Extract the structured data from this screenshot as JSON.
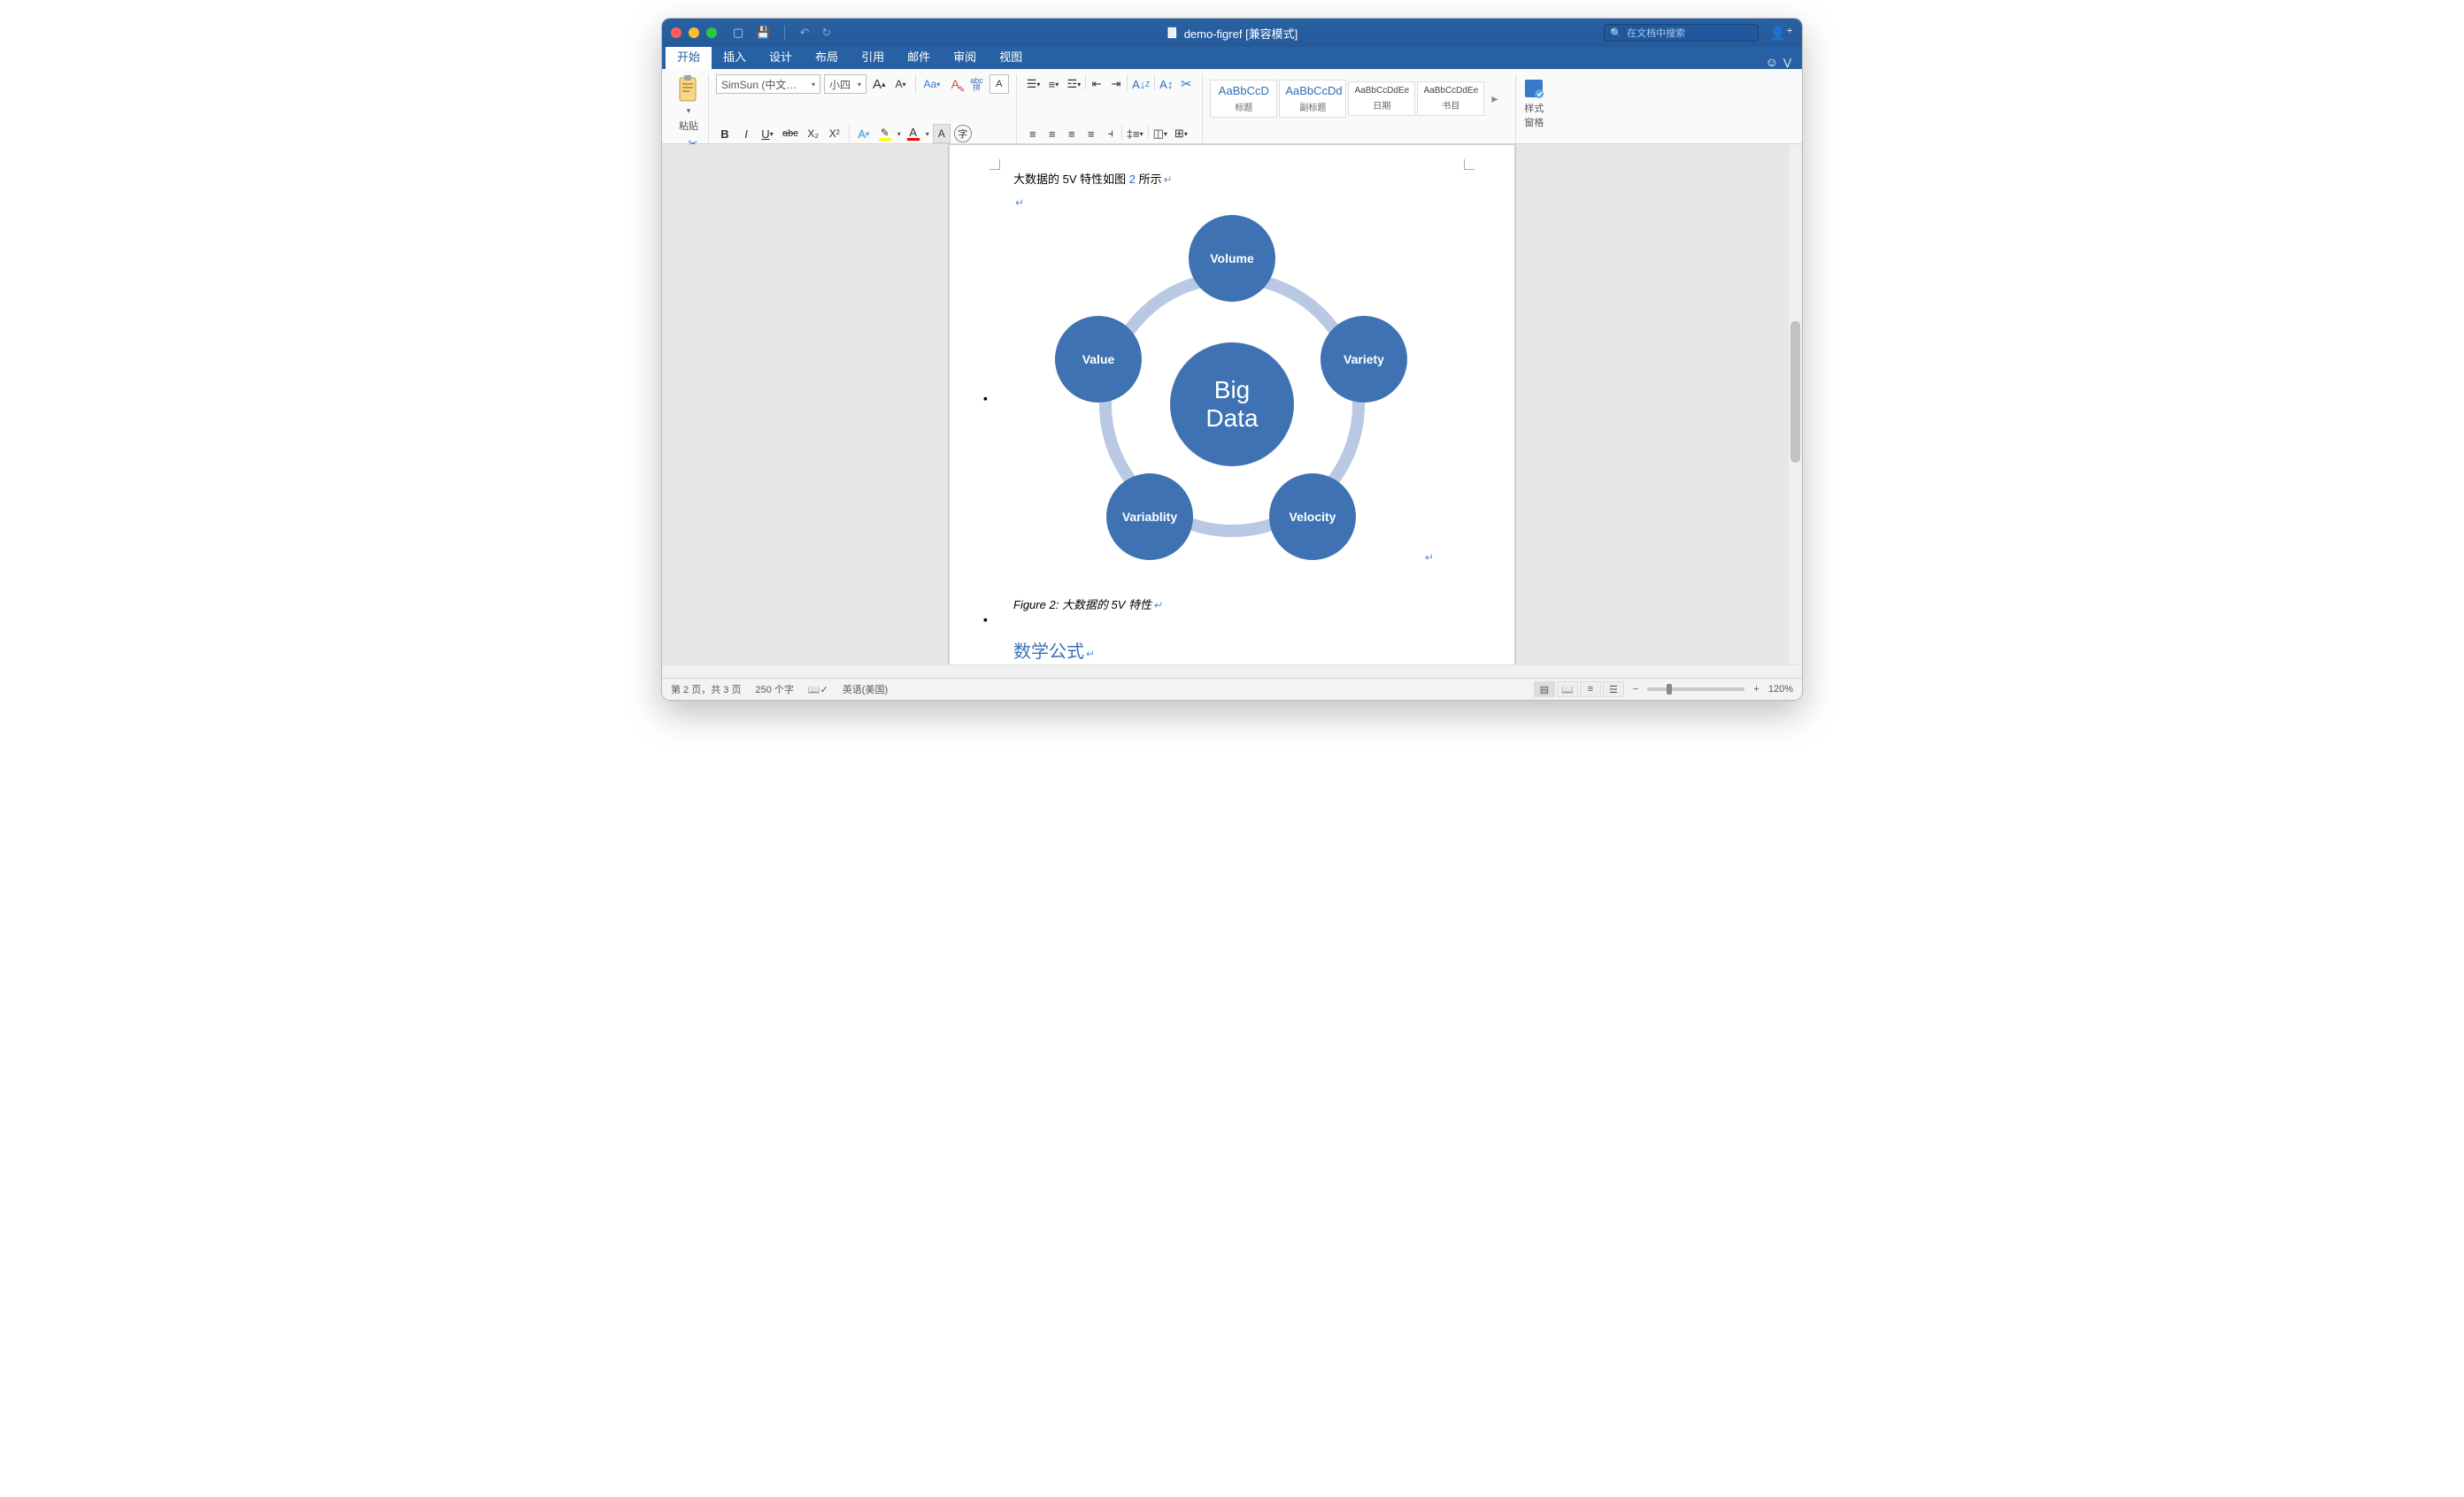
{
  "title": "demo-figref [兼容模式]",
  "search_placeholder": "在文档中搜索",
  "tabs": {
    "home": "开始",
    "insert": "插入",
    "design": "设计",
    "layout": "布局",
    "references": "引用",
    "mailings": "邮件",
    "review": "审阅",
    "view": "视图"
  },
  "ribbon": {
    "paste": "粘贴",
    "font_name": "SimSun (中文…",
    "font_size": "小四",
    "Aplus": "A",
    "Aminus": "A",
    "Aa": "Aa",
    "clear": "A",
    "phonetic": "abc拼",
    "A_box": "A",
    "bold": "B",
    "italic": "I",
    "underline": "U",
    "strike": "abc",
    "sub": "X₂",
    "sup": "X²",
    "Aoutline": "A",
    "highlightA": "A",
    "fontcolorA": "A",
    "A_dd": "A",
    "circ": "字",
    "styles": [
      {
        "preview": "AaBbCcD",
        "name": "标题",
        "cls": ""
      },
      {
        "preview": "AaBbCcDd",
        "name": "副标题",
        "cls": ""
      },
      {
        "preview": "AaBbCcDdEe",
        "name": "日期",
        "cls": "sm"
      },
      {
        "preview": "AaBbCcDdEe",
        "name": "书目",
        "cls": "sm"
      }
    ],
    "styles_pane": "样式\n窗格"
  },
  "document": {
    "line1_pre": "大数据的 5V 特性如图 ",
    "line1_ref": "2",
    "line1_post": " 所示",
    "diagram_center": "Big\nData",
    "nodes": {
      "volume": "Volume",
      "variety": "Variety",
      "velocity": "Velocity",
      "variability": "Variablity",
      "value": "Value"
    },
    "caption": "Figure 2: 大数据的 5V 特性",
    "heading": "数学公式"
  },
  "status": {
    "page": "第 2 页，共 3 页",
    "words": "250 个字",
    "lang": "英语(美国)",
    "zoom": "120%"
  }
}
